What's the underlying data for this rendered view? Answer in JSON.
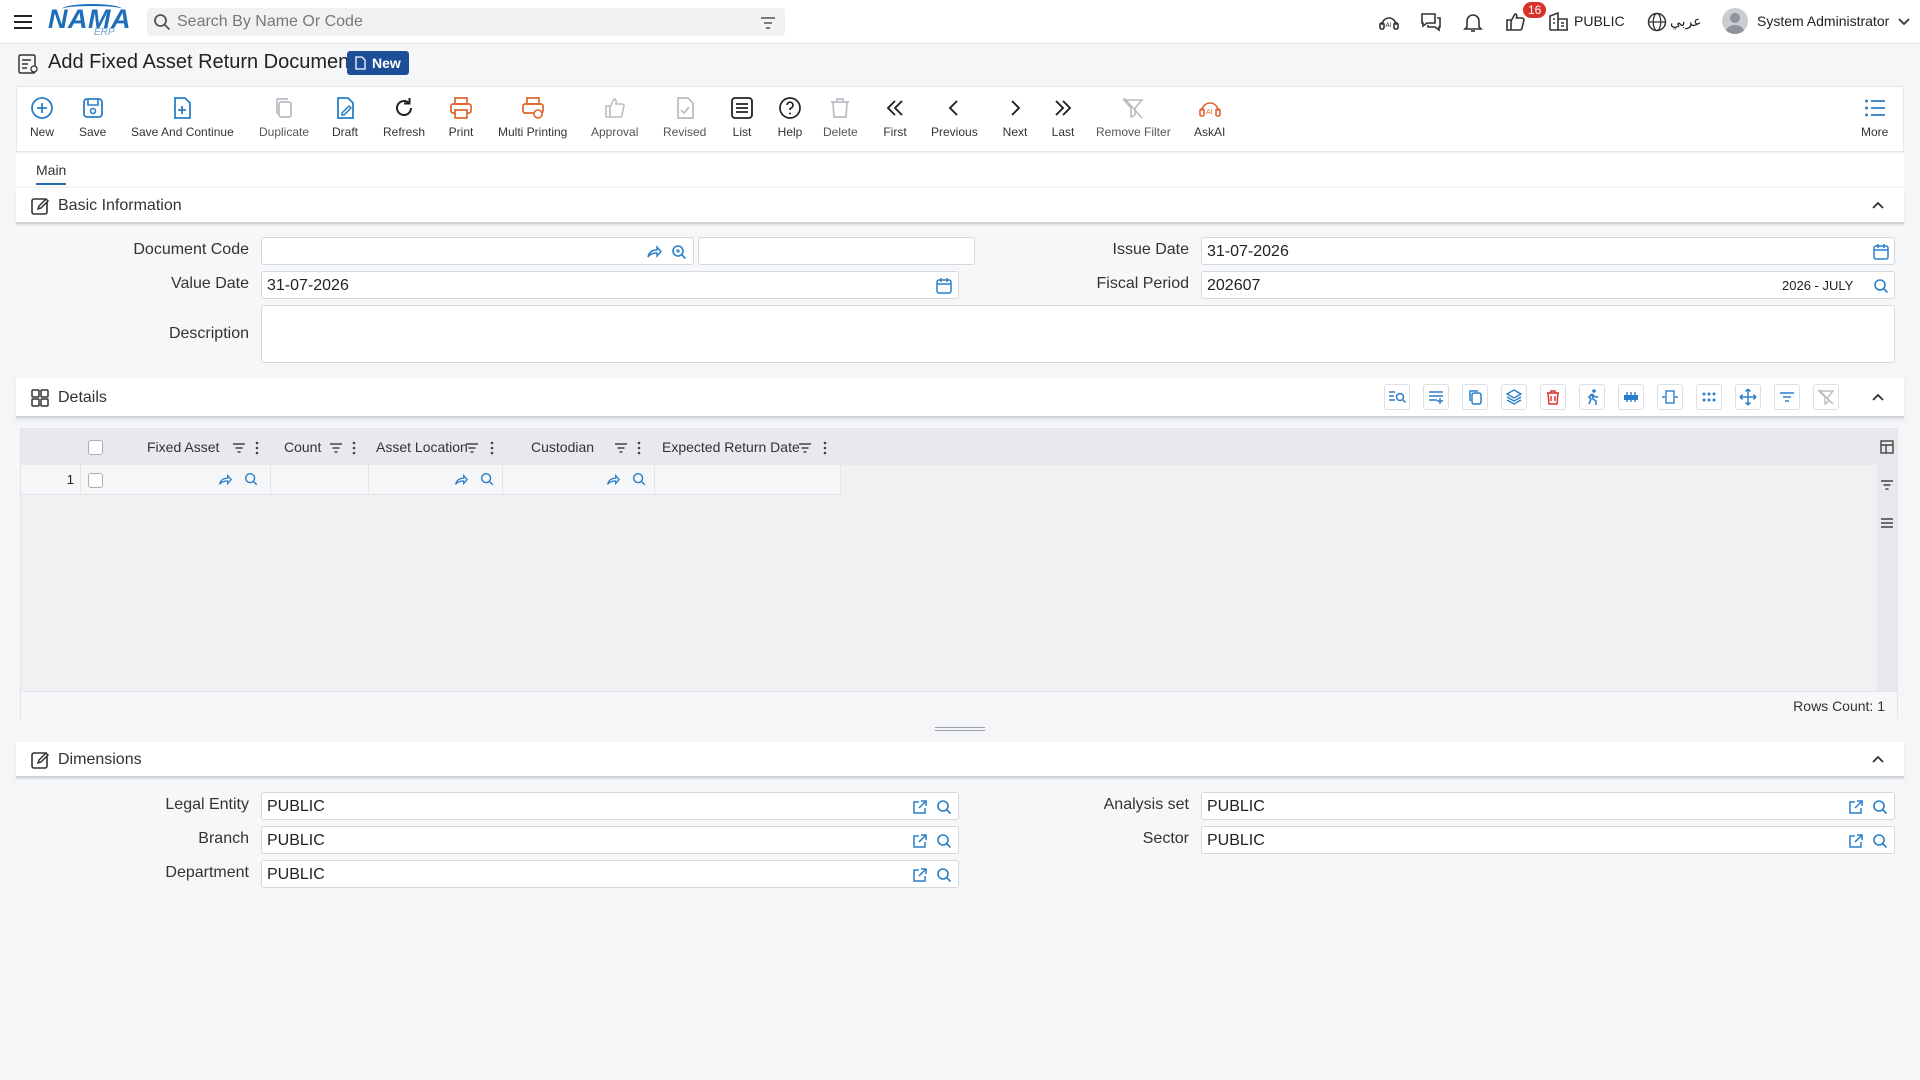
{
  "app": {
    "logo_text": "NAMA",
    "logo_sub": "ERP"
  },
  "search": {
    "placeholder": "Search By Name Or Code"
  },
  "topbar": {
    "notifications_count": "16",
    "company": "PUBLIC",
    "language": "عربي",
    "user": "System Administrator"
  },
  "page": {
    "title": "Add Fixed Asset Return Document",
    "status_badge": "New"
  },
  "toolbar": {
    "new": "New",
    "save": "Save",
    "save_continue": "Save And Continue",
    "duplicate": "Duplicate",
    "draft": "Draft",
    "refresh": "Refresh",
    "print": "Print",
    "multi_printing": "Multi Printing",
    "approval": "Approval",
    "revised": "Revised",
    "list": "List",
    "help": "Help",
    "delete": "Delete",
    "first": "First",
    "previous": "Previous",
    "next": "Next",
    "last": "Last",
    "remove_filter": "Remove Filter",
    "askai": "AskAI",
    "more": "More"
  },
  "tabs": {
    "main": "Main"
  },
  "basic": {
    "title": "Basic Information",
    "document_code_label": "Document Code",
    "document_code": "",
    "document_code_name": "",
    "issue_date_label": "Issue Date",
    "issue_date": "31-07-2026",
    "value_date_label": "Value Date",
    "value_date": "31-07-2026",
    "fiscal_period_label": "Fiscal Period",
    "fiscal_period": "202607",
    "fiscal_period_desc": "2026 - JULY",
    "description_label": "Description",
    "description": ""
  },
  "details": {
    "title": "Details",
    "columns": {
      "fixed_asset": "Fixed Asset",
      "count": "Count",
      "asset_location": "Asset Location",
      "custodian": "Custodian",
      "expected_return_date": "Expected Return Date"
    },
    "rows": [
      {
        "index": "1"
      }
    ],
    "rows_count": "Rows Count: 1"
  },
  "dimensions": {
    "title": "Dimensions",
    "legal_entity_label": "Legal Entity",
    "legal_entity": "PUBLIC",
    "analysis_set_label": "Analysis set",
    "analysis_set": "PUBLIC",
    "branch_label": "Branch",
    "branch": "PUBLIC",
    "sector_label": "Sector",
    "sector": "PUBLIC",
    "department_label": "Department",
    "department": "PUBLIC"
  },
  "colors": {
    "accent": "#1f4e99",
    "link": "#2a7fc9",
    "print": "#e0642b",
    "danger": "#d8312a"
  }
}
